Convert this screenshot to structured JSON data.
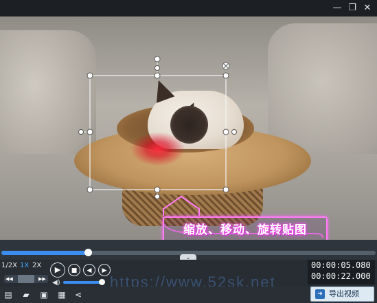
{
  "window": {
    "minimize_glyph": "—",
    "restore_glyph": "❐",
    "close_glyph": "✕"
  },
  "preview": {
    "caption": "缩放、移动、旋转贴图",
    "accent_color": "#ff7df5"
  },
  "scrubber": {
    "progress": 0.232,
    "collapse_glyph": "⌄"
  },
  "speed_options": [
    {
      "label": "1/2X",
      "active": false
    },
    {
      "label": "1X",
      "active": true
    },
    {
      "label": "2X",
      "active": false
    }
  ],
  "playback": {
    "play_glyph": "▶",
    "stop_glyph": "■",
    "prev_glyph": "◀",
    "next_glyph": "▶",
    "volume_level": 1.0
  },
  "time": {
    "current": "00:00:05.080",
    "total": "00:00:22.000"
  },
  "toolbar": {
    "export_label": "导出视频"
  },
  "watermark": "https://www.52sk.net"
}
